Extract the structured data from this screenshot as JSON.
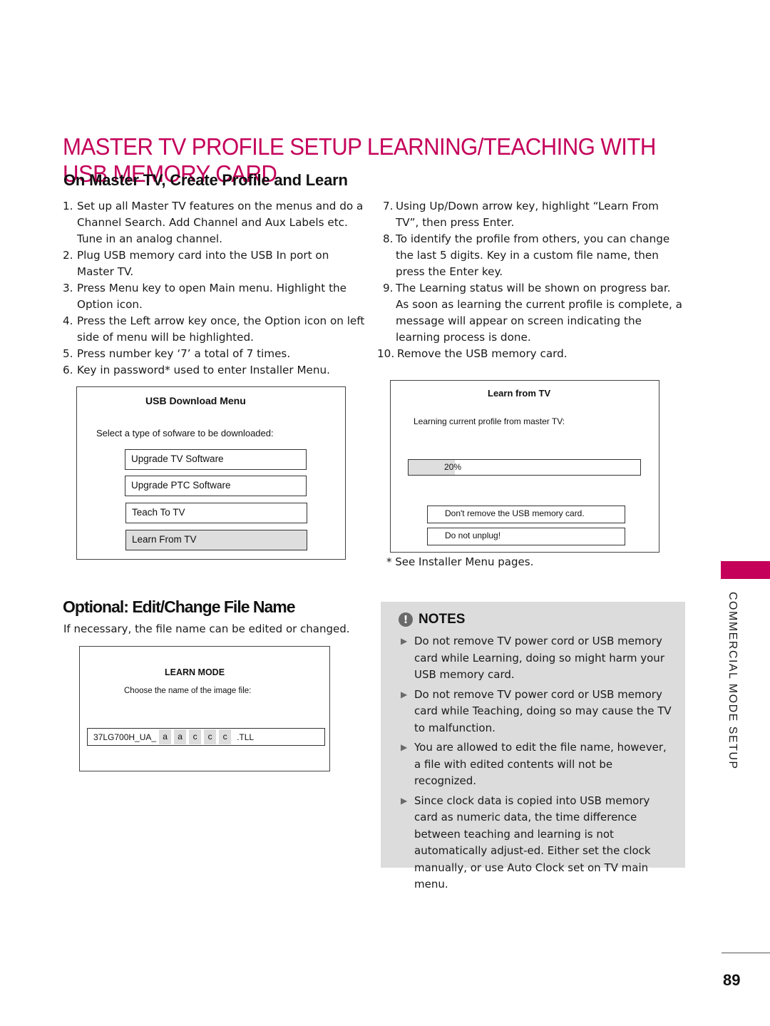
{
  "header": {
    "title": "MASTER TV PROFILE SETUP LEARNING/TEACHING WITH USB MEMORY CARD",
    "subtitle": "On Master TV, Create Profile and Learn"
  },
  "steps_left": [
    {
      "num": "1.",
      "text": "Set up all Master TV features on the menus and do a Channel Search. Add Channel and Aux Labels etc. Tune in an analog channel."
    },
    {
      "num": "2.",
      "text": "Plug USB memory card into the USB In port on Master TV."
    },
    {
      "num": "3.",
      "text": "Press Menu key to open Main menu. Highlight the Option icon."
    },
    {
      "num": "4.",
      "text": "Press the Left arrow key once, the Option icon on left side of menu will be highlighted."
    },
    {
      "num": "5.",
      "text": "Press number key ‘7’ a total of 7 times."
    },
    {
      "num": "6.",
      "text": "Key in password* used to enter Installer Menu."
    }
  ],
  "steps_right": [
    {
      "num": "7.",
      "text": "Using Up/Down arrow key, highlight “Learn From TV”, then press Enter."
    },
    {
      "num": "8.",
      "text": "To identify the profile from others, you can change the last 5 digits.  Key in a custom file name, then press the Enter key."
    },
    {
      "num": "9.",
      "text": "The Learning status will be shown on progress bar. As soon as learning the current profile is complete, a message will appear on screen indicating the learning process is done."
    },
    {
      "num": "10.",
      "text": "Remove the USB memory card."
    }
  ],
  "usb_menu": {
    "title": "USB Download Menu",
    "prompt": "Select a type of sofware to be downloaded:",
    "options": [
      {
        "label": "Upgrade TV Software",
        "selected": false
      },
      {
        "label": "Upgrade PTC Software",
        "selected": false
      },
      {
        "label": "Teach To TV",
        "selected": false
      },
      {
        "label": "Learn From TV",
        "selected": true
      }
    ]
  },
  "learn_tv": {
    "title": "Learn from TV",
    "prompt": "Learning current profile from master TV:",
    "progress_percent": 20,
    "progress_label": "20%",
    "warning_1": "Don't remove the USB memory card.",
    "warning_2": "Do not unplug!"
  },
  "footnote": "* See Installer Menu pages.",
  "optional": {
    "title": "Optional: Edit/Change File Name",
    "description": "If necessary, the file name can be edited or changed."
  },
  "learn_mode": {
    "title": "LEARN MODE",
    "prompt": "Choose the name of the image file:",
    "prefix": "37LG700H_UA_",
    "chars": [
      "a",
      "a",
      "c",
      "c",
      "c"
    ],
    "extension": ".TLL"
  },
  "notes": {
    "title": "NOTES",
    "icon": "exclamation-icon",
    "items": [
      "Do not remove TV power cord or USB memory card while Learning, doing so might harm your USB memory card.",
      "Do not remove TV power cord or USB memory card while Teaching, doing so may cause the TV to malfunction.",
      "You are allowed to edit the file name, however, a file with edited contents will not be recognized.",
      "Since clock data is copied into USB memory card as numeric data, the time difference between teaching and learning is not automatically adjust-ed. Either set the clock manually, or use Auto Clock set on TV main menu."
    ]
  },
  "side_section": "COMMERCIAL MODE SETUP",
  "page_number": "89",
  "colors": {
    "accent": "#c4005a",
    "notes_bg": "#dcdcdc",
    "highlight": "#dedede"
  }
}
